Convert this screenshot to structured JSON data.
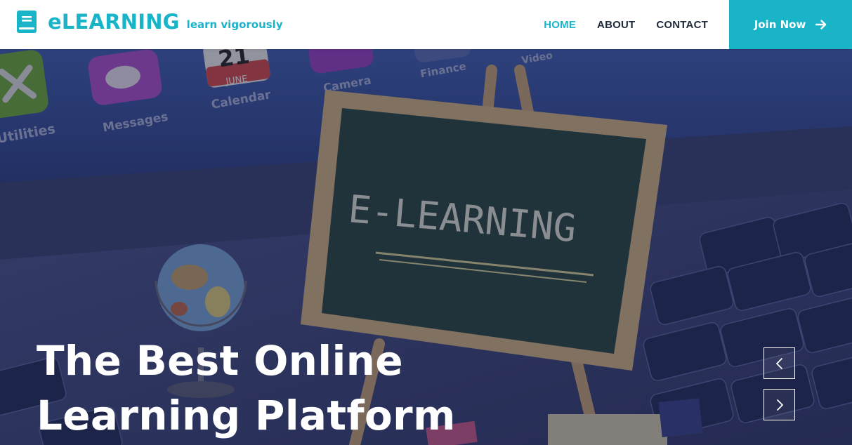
{
  "brand": {
    "name": "eLEARNING",
    "tagline": "learn vigorously",
    "color": "#1ab4c9",
    "icon": "book-icon"
  },
  "nav": {
    "items": [
      {
        "label": "HOME",
        "active": true
      },
      {
        "label": "ABOUT",
        "active": false
      },
      {
        "label": "CONTACT",
        "active": false
      }
    ],
    "cta": {
      "label": "Join Now",
      "icon": "arrow-right-icon"
    }
  },
  "hero": {
    "title_line1": "The Best Online",
    "title_line2": "Learning Platform",
    "chalkboard_text": "E-LEARNING",
    "background_labels": {
      "app1": "Utilities",
      "app2": "Messages",
      "calendar_day": "21",
      "calendar_month": "JUNE",
      "app3": "Calendar",
      "app4": "Camera",
      "app5": "Finance",
      "app6": "Video"
    },
    "controls": {
      "prev_icon": "chevron-left-icon",
      "next_icon": "chevron-right-icon"
    }
  }
}
